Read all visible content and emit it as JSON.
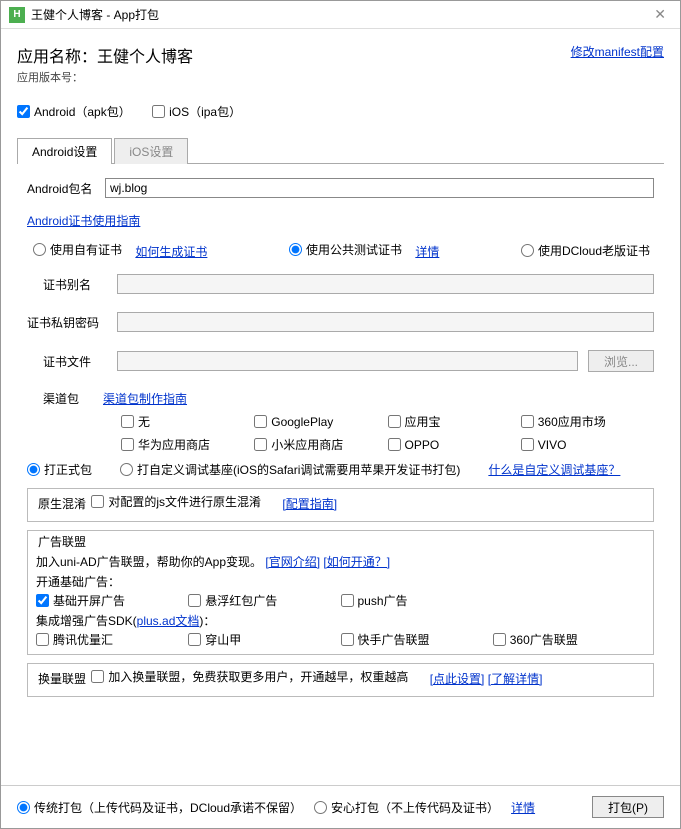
{
  "window": {
    "title": "王健个人博客 - App打包"
  },
  "header": {
    "app_name_label": "应用名称：",
    "app_name": "王健个人博客",
    "modify_manifest": "修改manifest配置",
    "version_label": "应用版本号："
  },
  "platforms": {
    "android": "Android（apk包）",
    "ios": "iOS（ipa包）"
  },
  "tabs": {
    "android": "Android设置",
    "ios": "iOS设置"
  },
  "android": {
    "pkg_label": "Android包名",
    "pkg_value": "wj.blog",
    "cert_guide": "Android证书使用指南",
    "cert_own": "使用自有证书",
    "cert_own_link": "如何生成证书",
    "cert_public": "使用公共测试证书",
    "cert_public_link": "详情",
    "cert_old": "使用DCloud老版证书",
    "alias_label": "证书别名",
    "key_label": "证书私钥密码",
    "file_label": "证书文件",
    "browse": "浏览...",
    "channel_label": "渠道包",
    "channel_guide": "渠道包制作指南",
    "channels": [
      "无",
      "GooglePlay",
      "应用宝",
      "360应用市场",
      "华为应用商店",
      "小米应用商店",
      "OPPO",
      "VIVO"
    ]
  },
  "packmode": {
    "official": "打正式包",
    "custom": "打自定义调试基座(iOS的Safari调试需要用苹果开发证书打包)",
    "custom_link": "什么是自定义调试基座？"
  },
  "obf": {
    "title": "原生混淆",
    "js_label": "对配置的js文件进行原生混淆",
    "guide": "[配置指南]"
  },
  "ads": {
    "title": "广告联盟",
    "intro_pre": "加入uni-AD广告联盟，帮助你的App变现。",
    "intro_link1": "[官网介绍]",
    "intro_link2": "[如何开通？]",
    "basic_title": "开通基础广告：",
    "basic": [
      "基础开屏广告",
      "悬浮红包广告",
      "push广告"
    ],
    "sdk_pre": "集成增强广告SDK(",
    "sdk_link": "plus.ad文档",
    "sdk_post": ")：",
    "sdk": [
      "腾讯优量汇",
      "穿山甲",
      "快手广告联盟",
      "360广告联盟"
    ]
  },
  "exchange": {
    "title": "换量联盟",
    "label": "加入换量联盟，免费获取更多用户，开通越早，权重越高",
    "link1": "[点此设置]",
    "link2": "[了解详情]"
  },
  "footer": {
    "traditional": "传统打包（上传代码及证书，DCloud承诺不保留）",
    "safe": "安心打包（不上传代码及证书）",
    "detail": "详情",
    "pack": "打包(P)"
  }
}
